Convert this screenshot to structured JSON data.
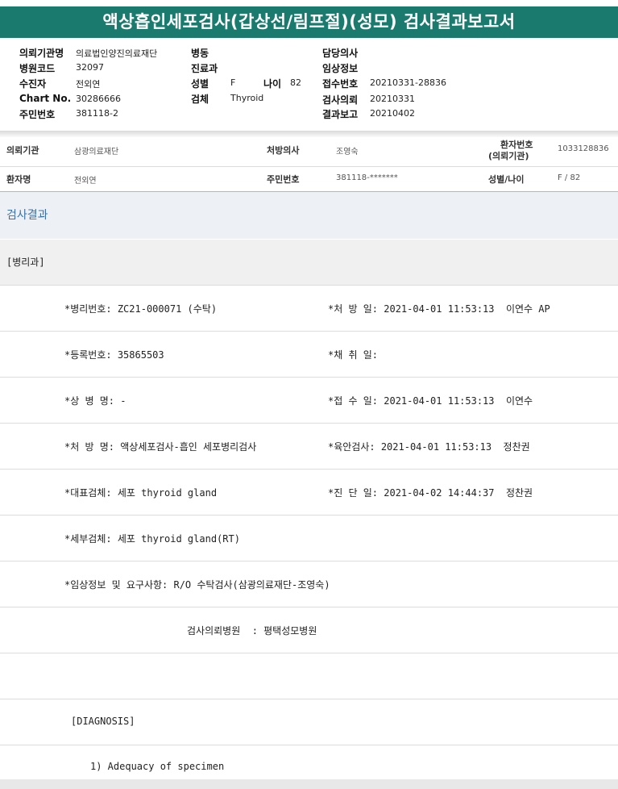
{
  "title": "액상흡인세포검사(갑상선/림프절)(성모) 검사결과보고서",
  "header": {
    "col1": [
      {
        "label": "의뢰기관명",
        "value": "의료법인양진의료재단"
      },
      {
        "label": "병원코드",
        "value": "32097"
      },
      {
        "label": "수진자",
        "value": "전외연"
      },
      {
        "label": "Chart No.",
        "value": "30286666"
      },
      {
        "label": "주민번호",
        "value": "381118-2"
      }
    ],
    "col2": {
      "ward_label": "병동",
      "dept_label": "진료과",
      "sex_label": "성별",
      "sex_value": "F",
      "age_label": "나이",
      "age_value": "82",
      "specimen_label": "검체",
      "specimen_value": "Thyroid"
    },
    "col3": [
      {
        "label": "담당의사",
        "value": ""
      },
      {
        "label": "임상정보",
        "value": ""
      },
      {
        "label": "접수번호",
        "value": "20210331-28836"
      },
      {
        "label": "검사의뢰",
        "value": "20210331"
      },
      {
        "label": "결과보고",
        "value": "20210402"
      }
    ]
  },
  "patient_info": {
    "org_label": "의뢰기관",
    "org_value": "삼광의료재단",
    "doctor_label": "처방의사",
    "doctor_value": "조영숙",
    "pid_label_1": "환자번호",
    "pid_label_2": "(의뢰기관)",
    "pid_value": "1033128836",
    "name_label": "환자명",
    "name_value": "전외연",
    "rrn_label": "주민번호",
    "rrn_value": "381118-*******",
    "sexage_label": "성별/나이",
    "sexage_value": "F / 82"
  },
  "section_title": "검사결과",
  "department": "[병리과]",
  "report_lines": [
    {
      "left": "*병리번호: ZC21-000071 (수탁)",
      "right": "*처 방 일: 2021-04-01 11:53:13  이연수 AP"
    },
    {
      "left": "*등록번호: 35865503",
      "right": "*채 취 일:"
    },
    {
      "left": "*상 병 명: -",
      "right": "*접 수 일: 2021-04-01 11:53:13  이연수"
    },
    {
      "left": "*처 방 명: 액상세포검사-흡인 세포병리검사",
      "right": "*육안검사: 2021-04-01 11:53:13  정찬권"
    },
    {
      "left": "*대표검체: 세포 thyroid gland",
      "right": "*진 단 일: 2021-04-02 14:44:37  정찬권"
    },
    {
      "left": "*세부검체: 세포 thyroid gland(RT)",
      "right": ""
    },
    {
      "left": "*임상정보 및 요구사항: R/O 수탁검사(삼광의료재단-조영숙)",
      "right": ""
    }
  ],
  "hospital_line": "검사의뢰병원  : 평택성모병원",
  "diagnosis_label": "[DIAGNOSIS]",
  "diagnosis_item": "1) Adequacy of specimen"
}
